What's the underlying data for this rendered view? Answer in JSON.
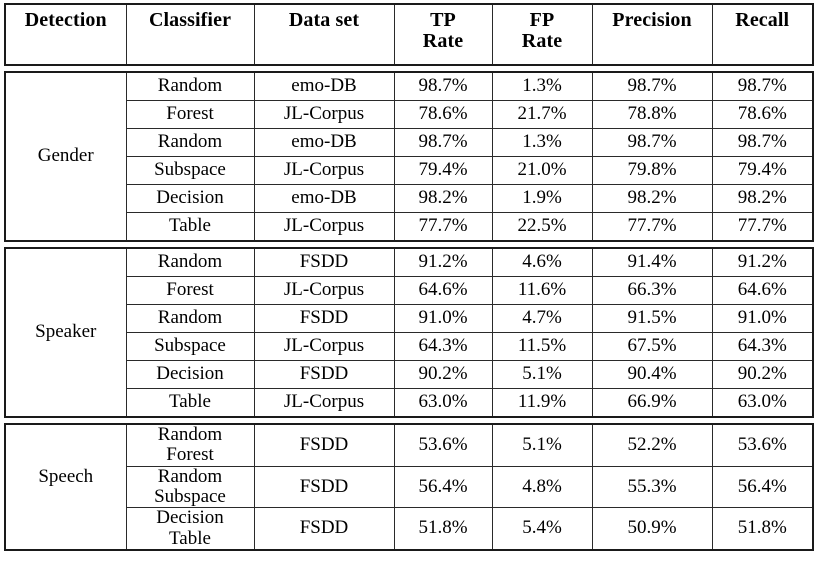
{
  "table": {
    "columns": [
      {
        "key": "detection",
        "label": "Detection",
        "lines": [
          "Detection"
        ]
      },
      {
        "key": "classifier",
        "label": "Classifier",
        "lines": [
          "Classifier"
        ]
      },
      {
        "key": "dataset",
        "label": "Data set",
        "lines": [
          "Data set"
        ]
      },
      {
        "key": "tp_rate",
        "label": "TP Rate",
        "lines": [
          "TP",
          "Rate"
        ]
      },
      {
        "key": "fp_rate",
        "label": "FP Rate",
        "lines": [
          "FP",
          "Rate"
        ]
      },
      {
        "key": "precision",
        "label": "Precision",
        "lines": [
          "Precision"
        ]
      },
      {
        "key": "recall",
        "label": "Recall",
        "lines": [
          "Recall"
        ]
      }
    ],
    "sections": [
      {
        "detection": "Gender",
        "groups": [
          {
            "classifier_lines": [
              "Random",
              "Forest"
            ],
            "rows": [
              {
                "dataset": "emo-DB",
                "tp_rate": "98.7%",
                "fp_rate": "1.3%",
                "precision": "98.7%",
                "recall": "98.7%"
              },
              {
                "dataset": "JL-Corpus",
                "tp_rate": "78.6%",
                "fp_rate": "21.7%",
                "precision": "78.8%",
                "recall": "78.6%"
              }
            ]
          },
          {
            "classifier_lines": [
              "Random",
              "Subspace"
            ],
            "rows": [
              {
                "dataset": "emo-DB",
                "tp_rate": "98.7%",
                "fp_rate": "1.3%",
                "precision": "98.7%",
                "recall": "98.7%"
              },
              {
                "dataset": "JL-Corpus",
                "tp_rate": "79.4%",
                "fp_rate": "21.0%",
                "precision": "79.8%",
                "recall": "79.4%"
              }
            ]
          },
          {
            "classifier_lines": [
              "Decision",
              "Table"
            ],
            "rows": [
              {
                "dataset": "emo-DB",
                "tp_rate": "98.2%",
                "fp_rate": "1.9%",
                "precision": "98.2%",
                "recall": "98.2%"
              },
              {
                "dataset": "JL-Corpus",
                "tp_rate": "77.7%",
                "fp_rate": "22.5%",
                "precision": "77.7%",
                "recall": "77.7%"
              }
            ]
          }
        ]
      },
      {
        "detection": "Speaker",
        "groups": [
          {
            "classifier_lines": [
              "Random",
              "Forest"
            ],
            "rows": [
              {
                "dataset": "FSDD",
                "tp_rate": "91.2%",
                "fp_rate": "4.6%",
                "precision": "91.4%",
                "recall": "91.2%"
              },
              {
                "dataset": "JL-Corpus",
                "tp_rate": "64.6%",
                "fp_rate": "11.6%",
                "precision": "66.3%",
                "recall": "64.6%"
              }
            ]
          },
          {
            "classifier_lines": [
              "Random",
              "Subspace"
            ],
            "rows": [
              {
                "dataset": "FSDD",
                "tp_rate": "91.0%",
                "fp_rate": "4.7%",
                "precision": "91.5%",
                "recall": "91.0%"
              },
              {
                "dataset": "JL-Corpus",
                "tp_rate": "64.3%",
                "fp_rate": "11.5%",
                "precision": "67.5%",
                "recall": "64.3%"
              }
            ]
          },
          {
            "classifier_lines": [
              "Decision",
              "Table"
            ],
            "rows": [
              {
                "dataset": "FSDD",
                "tp_rate": "90.2%",
                "fp_rate": "5.1%",
                "precision": "90.4%",
                "recall": "90.2%"
              },
              {
                "dataset": "JL-Corpus",
                "tp_rate": "63.0%",
                "fp_rate": "11.9%",
                "precision": "66.9%",
                "recall": "63.0%"
              }
            ]
          }
        ]
      },
      {
        "detection": "Speech",
        "groups": [
          {
            "classifier_lines": [
              "Random",
              "Forest"
            ],
            "rows": [
              {
                "dataset": "FSDD",
                "tp_rate": "53.6%",
                "fp_rate": "5.1%",
                "precision": "52.2%",
                "recall": "53.6%"
              }
            ]
          },
          {
            "classifier_lines": [
              "Random",
              "Subspace"
            ],
            "rows": [
              {
                "dataset": "FSDD",
                "tp_rate": "56.4%",
                "fp_rate": "4.8%",
                "precision": "55.3%",
                "recall": "56.4%"
              }
            ]
          },
          {
            "classifier_lines": [
              "Decision",
              "Table"
            ],
            "rows": [
              {
                "dataset": "FSDD",
                "tp_rate": "51.8%",
                "fp_rate": "5.4%",
                "precision": "50.9%",
                "recall": "51.8%"
              }
            ]
          }
        ]
      }
    ]
  }
}
